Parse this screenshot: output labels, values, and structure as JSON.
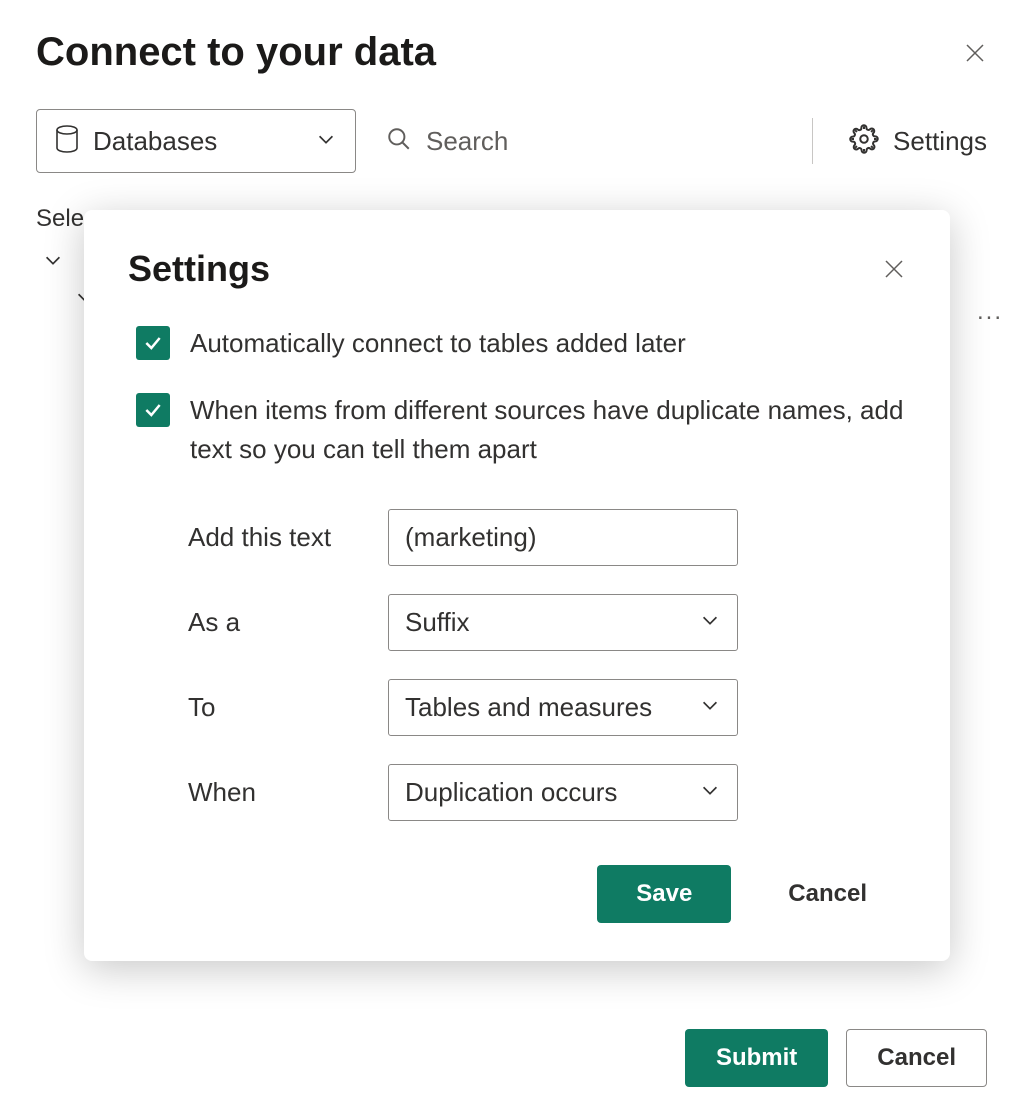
{
  "main": {
    "title": "Connect to your data",
    "db_dropdown": "Databases",
    "search_placeholder": "Search",
    "settings_label": "Settings",
    "bg_select_partial": "Sele",
    "submit_label": "Submit",
    "cancel_label": "Cancel",
    "ellipsis": "..."
  },
  "modal": {
    "title": "Settings",
    "checks": {
      "auto_connect": "Automatically connect to tables added later",
      "dup_names": "When items from different sources have duplicate names, add text so you can tell them apart"
    },
    "form": {
      "add_text_label": "Add this text",
      "add_text_value": "(marketing)",
      "as_a_label": "As a",
      "as_a_value": "Suffix",
      "to_label": "To",
      "to_value": "Tables and measures",
      "when_label": "When",
      "when_value": "Duplication occurs"
    },
    "save_label": "Save",
    "cancel_label": "Cancel"
  }
}
